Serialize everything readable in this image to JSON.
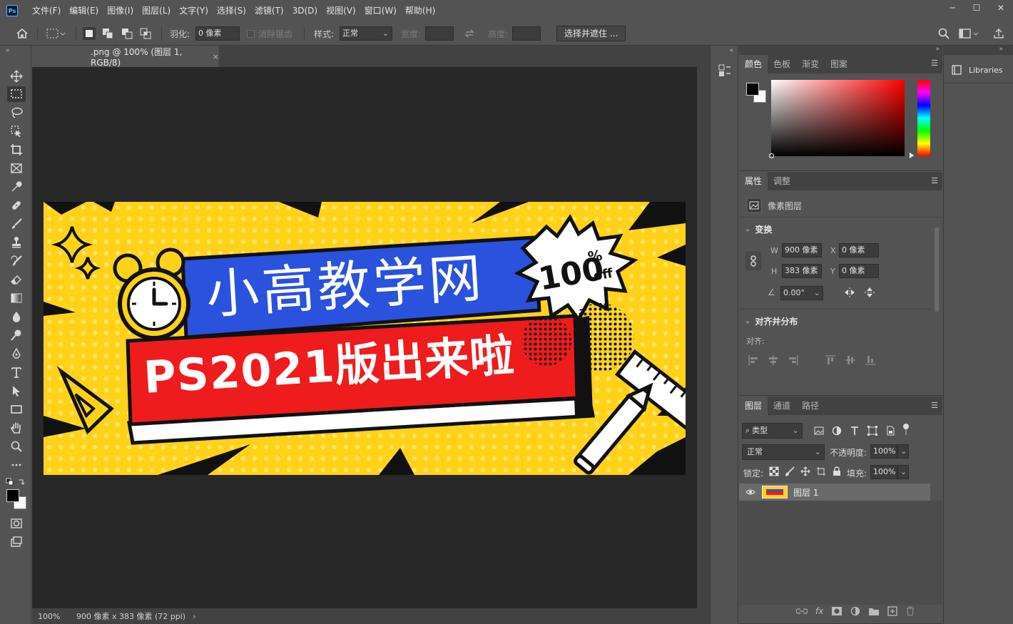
{
  "menubar": {
    "logo": "Ps",
    "items": [
      "文件(F)",
      "编辑(E)",
      "图像(I)",
      "图层(L)",
      "文字(Y)",
      "选择(S)",
      "滤镜(T)",
      "3D(D)",
      "视图(V)",
      "窗口(W)",
      "帮助(H)"
    ]
  },
  "options": {
    "feather_label": "羽化:",
    "feather_value": "0 像素",
    "antialias_label": "消除锯齿",
    "style_label": "样式:",
    "style_value": "正常",
    "width_label": "宽度:",
    "height_label": "高度:",
    "select_mask_button": "选择并遮住 ..."
  },
  "document": {
    "tab_title": ".png @ 100% (图层 1, RGB/8)",
    "zoom": "100%",
    "size_info": "900 像素 x 383 像素 (72 ppi)"
  },
  "banner": {
    "title": "小高教学网",
    "subtitle": "PS2021版出来啦",
    "badge_number": "100",
    "badge_percent": "%",
    "badge_off": "off",
    "colors": {
      "yellow": "#ffd21a",
      "blue": "#2a52dd",
      "red": "#ee1c1c",
      "black": "#111111",
      "white": "#ffffff"
    }
  },
  "color_panel": {
    "tabs": [
      "颜色",
      "色板",
      "渐变",
      "图案"
    ],
    "foreground": "#000000",
    "background": "#ffffff",
    "hue": "#ff0000"
  },
  "properties_panel": {
    "tabs": [
      "属性",
      "调整"
    ],
    "layer_type": "像素图层",
    "transform_title": "变换",
    "w_label": "W",
    "w_value": "900 像素",
    "h_label": "H",
    "h_value": "383 像素",
    "x_label": "X",
    "x_value": "0 像素",
    "y_label": "Y",
    "y_value": "0 像素",
    "angle_value": "0.00°",
    "align_title": "对齐并分布",
    "align_label": "对齐:"
  },
  "layers_panel": {
    "tabs": [
      "图层",
      "通道",
      "路径"
    ],
    "filter_type": "类型",
    "blend_mode": "正常",
    "opacity_label": "不透明度:",
    "opacity_value": "100%",
    "lock_label": "锁定:",
    "fill_label": "填充:",
    "fill_value": "100%",
    "layer_name": "图层 1"
  },
  "libraries": {
    "label": "Libraries"
  }
}
